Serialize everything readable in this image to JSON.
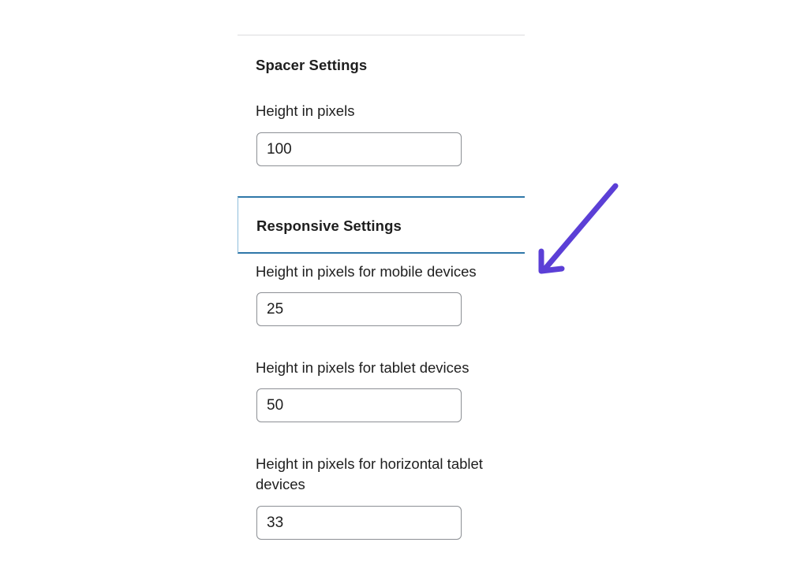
{
  "spacer_settings": {
    "title": "Spacer Settings",
    "height": {
      "label": "Height in pixels",
      "value": "100"
    }
  },
  "responsive_settings": {
    "title": "Responsive Settings",
    "mobile": {
      "label": "Height in pixels for mobile devices",
      "value": "25"
    },
    "tablet": {
      "label": "Height in pixels for tablet devices",
      "value": "50"
    },
    "horizontal_tablet": {
      "label": "Height in pixels for horizontal tablet devices",
      "value": "33"
    }
  },
  "annotation": {
    "icon": "arrow-down-left-icon",
    "color": "#5b3fd6"
  },
  "colors": {
    "highlight_border": "#2f77a8",
    "input_border": "#8c8f94",
    "divider": "#dcdcde"
  }
}
